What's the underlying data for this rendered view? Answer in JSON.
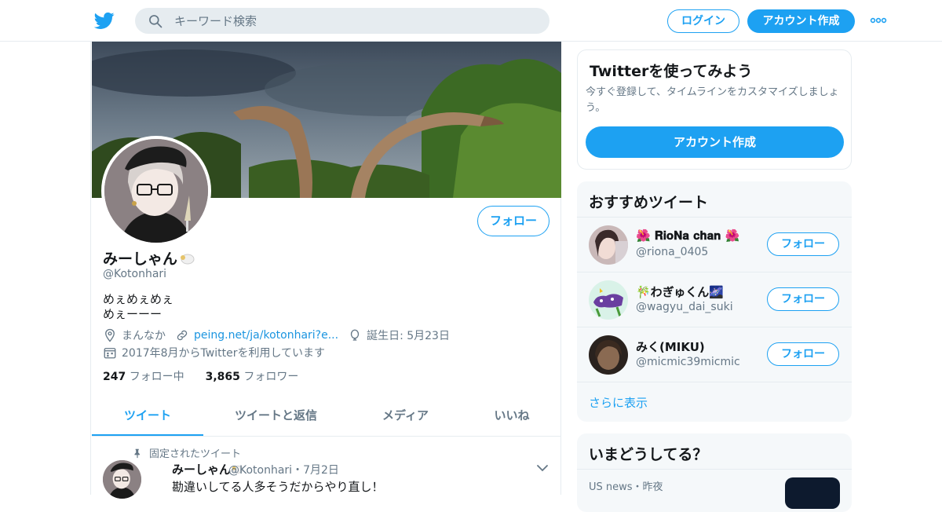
{
  "header": {
    "search_placeholder": "キーワード検索",
    "login_label": "ログイン",
    "signup_label": "アカウント作成"
  },
  "profile": {
    "name": "みーしゃん",
    "handle": "@Kotonhari",
    "bio_line1": "めぇめぇめぇ",
    "bio_line2": "めぇーーー",
    "location": "まんなか",
    "url": "peing.net/ja/kotonhari?e...",
    "birthday": "誕生日: 5月23日",
    "joined": "2017年8月からTwitterを利用しています",
    "following_count": "247",
    "following_label": "フォロー中",
    "followers_count": "3,865",
    "followers_label": "フォロワー",
    "follow_button": "フォロー"
  },
  "tabs": [
    {
      "label": "ツイート"
    },
    {
      "label": "ツイートと返信"
    },
    {
      "label": "メディア"
    },
    {
      "label": "いいね"
    }
  ],
  "pinned_tweet": {
    "pinned_label": "固定されたツイート",
    "name": "みーしゃん",
    "handle_date": "@Kotonhari・7月2日",
    "text": "勘違いしてる人多そうだからやり直し！"
  },
  "signup_card": {
    "title": "Twitterを使ってみよう",
    "body": "今すぐ登録して、タイムラインをカスタマイズしましょう。",
    "button": "アカウント作成"
  },
  "suggestions": {
    "title": "おすすめツイート",
    "follow_label": "フォロー",
    "items": [
      {
        "name": "🌺 𝐑𝐢𝐨𝐍𝐚 𝐜𝐡𝐚𝐧 🌺",
        "handle": "@riona_0405"
      },
      {
        "name": "🎋わぎゅくん🌌",
        "handle": "@wagyu_dai_suki"
      },
      {
        "name": "みく(MIKU)",
        "handle": "@micmic39micmic"
      }
    ],
    "show_more": "さらに表示"
  },
  "trends": {
    "title": "いまどうしてる？",
    "item_meta": "US news・昨夜"
  },
  "colors": {
    "accent": "#1da1f2",
    "text_secondary": "#657786"
  }
}
